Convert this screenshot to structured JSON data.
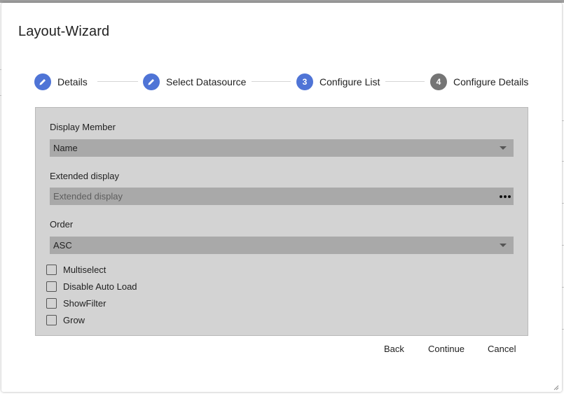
{
  "dialog": {
    "title": "Layout-Wizard"
  },
  "stepper": {
    "steps": [
      {
        "label": "Details",
        "state": "done",
        "icon": "pencil-icon"
      },
      {
        "label": "Select Datasource",
        "state": "done",
        "icon": "pencil-icon"
      },
      {
        "label": "Configure List",
        "state": "active",
        "number": "3"
      },
      {
        "label": "Configure Details",
        "state": "todo",
        "number": "4"
      }
    ]
  },
  "form": {
    "display_member": {
      "label": "Display Member",
      "value": "Name"
    },
    "extended_display": {
      "label": "Extended display",
      "placeholder": "Extended display"
    },
    "order": {
      "label": "Order",
      "value": "ASC"
    },
    "checkboxes": [
      {
        "label": "Multiselect",
        "checked": false
      },
      {
        "label": "Disable Auto Load",
        "checked": false
      },
      {
        "label": "ShowFilter",
        "checked": false
      },
      {
        "label": "Grow",
        "checked": false
      }
    ]
  },
  "footer": {
    "back_label": "Back",
    "continue_label": "Continue",
    "cancel_label": "Cancel"
  },
  "colors": {
    "step_active": "#4f74d6",
    "step_todo": "#757575",
    "panel_bg": "#d3d3d3",
    "field_bg": "#a9a9a9"
  }
}
